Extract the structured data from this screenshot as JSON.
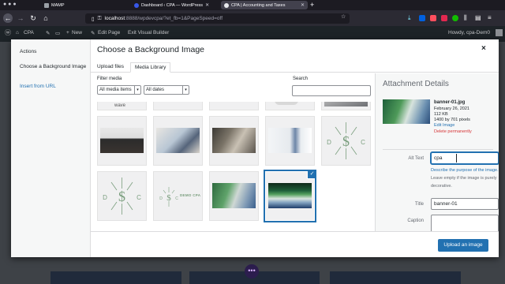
{
  "browser": {
    "tabs": [
      {
        "label": "MAMP",
        "active": false
      },
      {
        "label": "Dashboard ‹ CPA — WordPress",
        "active": false
      },
      {
        "label": "CPA | Accounting and Taxes",
        "active": true
      }
    ],
    "new_tab": "+",
    "url": {
      "host": "localhost",
      "rest": ":8888/wpdevcpa/?et_fb=1&PageSpeed=off"
    }
  },
  "adminbar": {
    "site": "CPA",
    "new": "New",
    "edit_page": "Edit Page",
    "exit_builder": "Exit Visual Builder",
    "howdy": "Howdy, cpa-Dem0"
  },
  "modal": {
    "menu": {
      "actions": "Actions",
      "choose": "Choose a Background Image",
      "insert": "Insert from URL"
    },
    "title": "Choose a Background Image",
    "close": "×",
    "tabs": {
      "upload": "Upload files",
      "library": "Media Library"
    },
    "filter": {
      "label": "Filter media",
      "type": "All media items",
      "date": "All dates"
    },
    "search_label": "Search",
    "thumb_texts": {
      "wave": "wave",
      "demo": "DEMO CPA"
    },
    "details": {
      "heading": "Attachment Details",
      "filename": "banner-01.jpg",
      "date": "February 26, 2021",
      "size": "112 KB",
      "dimensions": "1400 by 701 pixels",
      "edit": "Edit Image",
      "delete": "Delete permanently",
      "alt_label": "Alt Text",
      "alt_value": "cpa",
      "alt_help_link": "Describe the purpose of the image.",
      "alt_help_rest": " Leave empty if the image is purely decorative.",
      "title_label": "Title",
      "title_value": "banner-01",
      "caption_label": "Caption"
    },
    "upload_button": "Upload an image"
  },
  "colors": {
    "accent": "#2271b1",
    "adminbar": "#1d2327",
    "delete": "#d63638"
  }
}
